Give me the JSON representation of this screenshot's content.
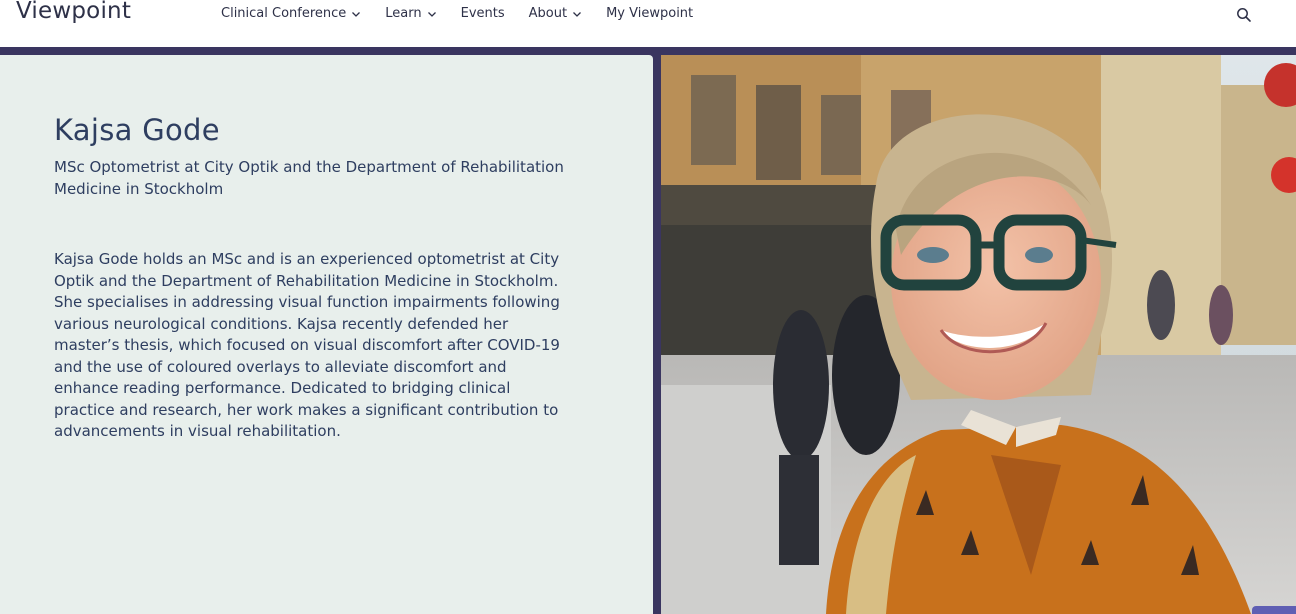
{
  "header": {
    "logo": "Viewpoint",
    "nav": [
      {
        "label": "Clinical Conference",
        "has_dropdown": true
      },
      {
        "label": "Learn",
        "has_dropdown": true
      },
      {
        "label": "Events",
        "has_dropdown": false
      },
      {
        "label": "About",
        "has_dropdown": true
      },
      {
        "label": "My Viewpoint",
        "has_dropdown": false
      }
    ],
    "search_icon": "search-icon"
  },
  "profile": {
    "name": "Kajsa Gode",
    "role": "MSc Optometrist at City Optik and the Department of Rehabilitation Medicine in Stockholm",
    "bio": "Kajsa Gode holds an MSc and is an experienced optometrist at City Optik and the Department of Rehabilitation Medicine in Stockholm. She specialises in addressing visual function impairments following various neurological conditions. Kajsa recently defended her master’s thesis, which focused on visual discomfort after COVID-19 and the use of coloured overlays to alleviate discomfort and enhance reading performance. Dedicated to bridging clinical practice and research, her work makes a significant contribution to advancements in visual rehabilitation."
  },
  "colors": {
    "band": "#3a3560",
    "panel": "#e8efec",
    "text": "#2e3e60",
    "shirt": "#c8711c"
  }
}
